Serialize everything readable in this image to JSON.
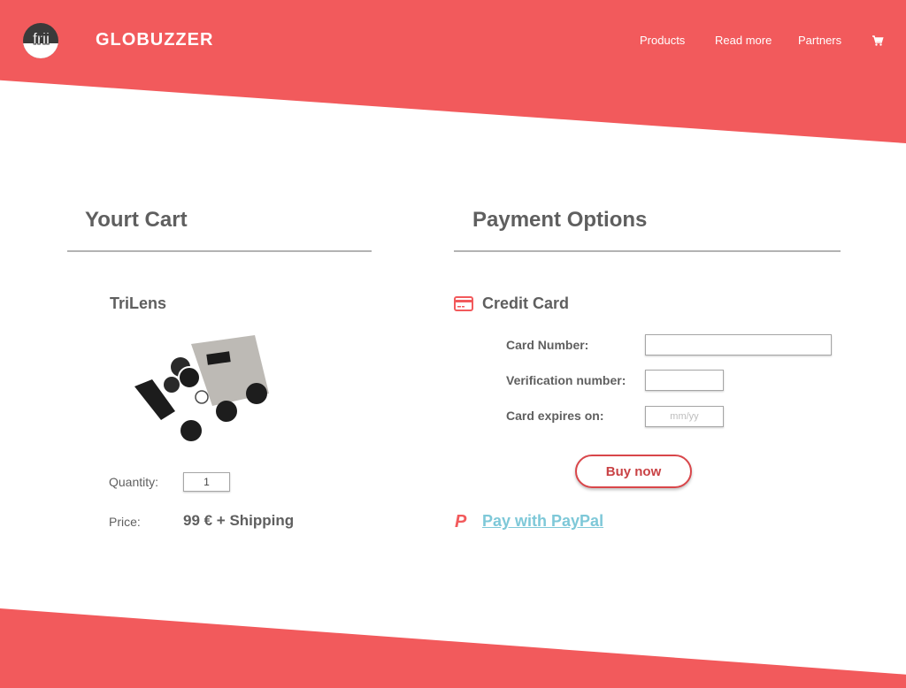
{
  "header": {
    "logo_text": "frii",
    "brand": "GLOBUZZER",
    "nav": [
      "Products",
      "Read more",
      "Partners"
    ],
    "cart_icon": "shopping-cart-icon"
  },
  "cart": {
    "title": "Yourt Cart",
    "product_name": "TriLens",
    "quantity_label": "Quantity:",
    "quantity_value": "1",
    "price_label": "Price:",
    "price_value": "99 € + Shipping"
  },
  "payment": {
    "title": "Payment Options",
    "credit_card_label": "Credit Card",
    "card_number_label": "Card Number:",
    "verification_label": "Verification number:",
    "expires_label": "Card expires on:",
    "expires_placeholder": "mm/yy",
    "buy_button": "Buy now",
    "paypal_link": "Pay with PayPal",
    "paypal_icon_glyph": "P"
  },
  "colors": {
    "accent": "#f25a5c",
    "button_border": "#d9464a",
    "link": "#7ec8d8"
  }
}
